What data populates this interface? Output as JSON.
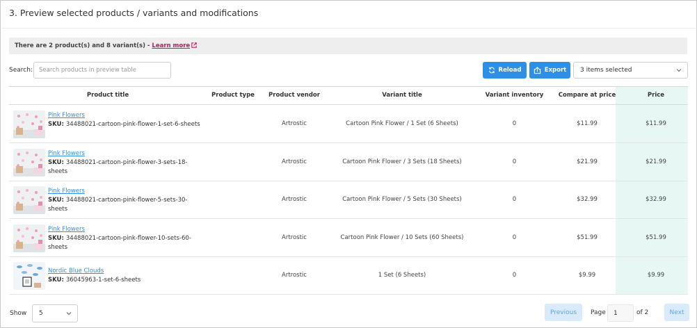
{
  "section_title": "3. Preview selected products / variants and modifications",
  "info": {
    "text": "There are 2 product(s) and 8 variant(s) - ",
    "link": "Learn more"
  },
  "search": {
    "label": "Search:",
    "placeholder": "Search products in preview table",
    "value": ""
  },
  "toolbar": {
    "reload_label": "Reload",
    "export_label": "Export",
    "items_selected": "3 items selected"
  },
  "table": {
    "headers": {
      "product_title": "Product title",
      "product_type": "Product type",
      "product_vendor": "Product vendor",
      "variant_title": "Variant title",
      "variant_inventory": "Variant inventory",
      "compare_at_price": "Compare at price",
      "price": "Price"
    },
    "sku_label": "SKU:",
    "rows": [
      {
        "product": "Pink Flowers",
        "sku": "34488021-cartoon-pink-flower-1-set-6-sheets",
        "type": "",
        "vendor": "Artrostic",
        "variant": "Cartoon Pink Flower / 1 Set (6 Sheets)",
        "inventory": "0",
        "compare": "$11.99",
        "price": "$11.99",
        "thumb": "pink"
      },
      {
        "product": "Pink Flowers",
        "sku": "34488021-cartoon-pink-flower-3-sets-18-sheets",
        "type": "",
        "vendor": "Artrostic",
        "variant": "Cartoon Pink Flower / 3 Sets (18 Sheets)",
        "inventory": "0",
        "compare": "$21.99",
        "price": "$21.99",
        "thumb": "pink"
      },
      {
        "product": "Pink Flowers",
        "sku": "34488021-cartoon-pink-flower-5-sets-30-sheets",
        "type": "",
        "vendor": "Artrostic",
        "variant": "Cartoon Pink Flower / 5 Sets (30 Sheets)",
        "inventory": "0",
        "compare": "$32.99",
        "price": "$32.99",
        "thumb": "pink"
      },
      {
        "product": "Pink Flowers",
        "sku": "34488021-cartoon-pink-flower-10-sets-60-sheets",
        "type": "",
        "vendor": "Artrostic",
        "variant": "Cartoon Pink Flower / 10 Sets (60 Sheets)",
        "inventory": "0",
        "compare": "$51.99",
        "price": "$51.99",
        "thumb": "pink"
      },
      {
        "product": "Nordic Blue Clouds",
        "sku": "36045963-1-set-6-sheets",
        "type": "",
        "vendor": "Artrostic",
        "variant": "1 Set (6 Sheets)",
        "inventory": "0",
        "compare": "$9.99",
        "price": "$9.99",
        "thumb": "blue"
      }
    ]
  },
  "pagination": {
    "show_label": "Show",
    "page_size": "5",
    "previous": "Previous",
    "page_label": "Page",
    "current_page": "1",
    "of_label": "of 2",
    "next": "Next"
  },
  "colors": {
    "accent": "#2f8fe6",
    "link": "#c2185b",
    "price_column": "#e6f7f4"
  }
}
